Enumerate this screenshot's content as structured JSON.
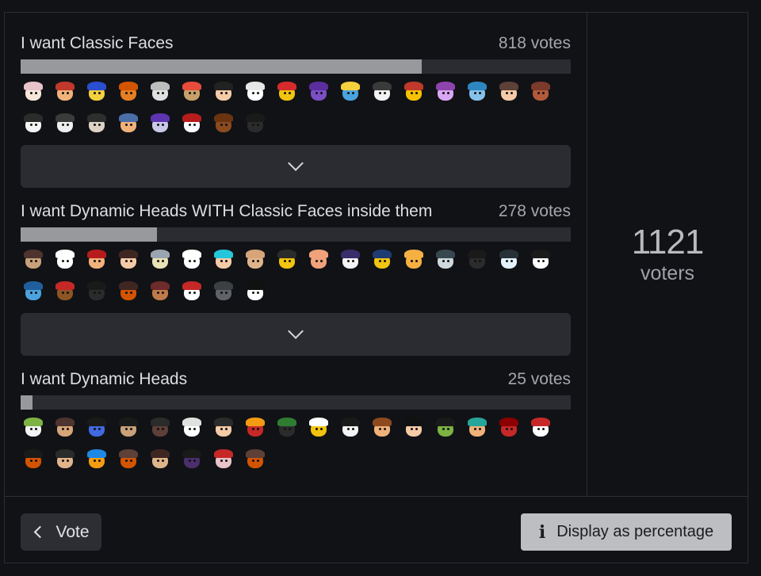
{
  "poll": {
    "total_voters": "1121",
    "voters_label": "voters",
    "options": [
      {
        "label": "I want Classic Faces",
        "votes": "818 votes",
        "fraction": 0.7297,
        "avatars": [
          {
            "skin": "#f6e7da",
            "hat": "#e8c3c9"
          },
          {
            "skin": "#f0b27a",
            "hat": "#c0392b"
          },
          {
            "skin": "#f4d03f",
            "hat": "#2a4fd0"
          },
          {
            "skin": "#e67e22",
            "hat": "#d35400"
          },
          {
            "skin": "#e0e0e0",
            "hat": "#bdbdbd"
          },
          {
            "skin": "#c8a06a",
            "hat": "#e74c3c"
          },
          {
            "skin": "#f5cba7",
            "hat": "#222222"
          },
          {
            "skin": "#ffffff",
            "hat": "#e7e7e7"
          },
          {
            "skin": "#f1c40f",
            "hat": "#d62b2b"
          },
          {
            "skin": "#7b4fc4",
            "hat": "#5b2e9e"
          },
          {
            "skin": "#4aa3df",
            "hat": "#f4d03f"
          },
          {
            "skin": "#f2f2f2",
            "hat": "#3a3a3a"
          },
          {
            "skin": "#f6c200",
            "hat": "#c0392b"
          },
          {
            "skin": "#d9a7f2",
            "hat": "#8e44ad"
          },
          {
            "skin": "#85c1e9",
            "hat": "#2e86c1"
          },
          {
            "skin": "#f5cba7",
            "hat": "#5d4037"
          },
          {
            "skin": "#b35a3a",
            "hat": "#7b3a2a"
          },
          {
            "skin": "#f4f4f4",
            "hat": "#2b2b2b"
          },
          {
            "skin": "#eeeeee",
            "hat": "#3b3b3b"
          },
          {
            "skin": "#ddd2c4",
            "hat": "#2e2e2e"
          },
          {
            "skin": "#f0b27a",
            "hat": "#4a6ea8"
          },
          {
            "skin": "#c9c9e8",
            "hat": "#5e35b1"
          },
          {
            "skin": "#ffffff",
            "hat": "#b71c1c"
          },
          {
            "skin": "#8d4a1f",
            "hat": "#6b3410"
          },
          {
            "skin": "#2b2b2b",
            "hat": "#1a1a1a"
          }
        ]
      },
      {
        "label": "I want Dynamic Heads WITH Classic Faces inside them",
        "votes": "278 votes",
        "fraction": 0.248,
        "avatars": [
          {
            "skin": "#c8a07a",
            "hat": "#4e342e"
          },
          {
            "skin": "#ffffff",
            "hat": "#ffffff"
          },
          {
            "skin": "#f0b27a",
            "hat": "#b71c1c"
          },
          {
            "skin": "#f5cba7",
            "hat": "#3e2723"
          },
          {
            "skin": "#e9e3b5",
            "hat": "#9aa5b1"
          },
          {
            "skin": "#ffffff",
            "hat": "#ffffff"
          },
          {
            "skin": "#f5cba7",
            "hat": "#26c6da"
          },
          {
            "skin": "#e0b48a",
            "hat": "#d7a57a"
          },
          {
            "skin": "#f1c40f",
            "hat": "#2b2b2b"
          },
          {
            "skin": "#f0a27a",
            "hat": "#f0a27a"
          },
          {
            "skin": "#f4f4f4",
            "hat": "#3a2d6b"
          },
          {
            "skin": "#f1c40f",
            "hat": "#1f3b73"
          },
          {
            "skin": "#f5b041",
            "hat": "#f5b041"
          },
          {
            "skin": "#cfd8dc",
            "hat": "#37474f"
          },
          {
            "skin": "#2b2b2b",
            "hat": "#1a1a1a"
          },
          {
            "skin": "#e3f2fd",
            "hat": "#263238"
          },
          {
            "skin": "#ffffff",
            "hat": "#1a1a1a"
          },
          {
            "skin": "#4aa3df",
            "hat": "#1f5f9e"
          },
          {
            "skin": "#8d5524",
            "hat": "#c62828"
          },
          {
            "skin": "#2b2b2b",
            "hat": "#1a1a1a"
          },
          {
            "skin": "#d35400",
            "hat": "#3e2723"
          },
          {
            "skin": "#c0794a",
            "hat": "#6d2b2b"
          },
          {
            "skin": "#ffffff",
            "hat": "#c62828"
          },
          {
            "skin": "#5f6368",
            "hat": "#3c4043"
          },
          {
            "skin": "#ffffff",
            "hat": "#111111"
          }
        ]
      },
      {
        "label": "I want Dynamic Heads",
        "votes": "25 votes",
        "fraction": 0.0223,
        "avatars": [
          {
            "skin": "#f4f4f4",
            "hat": "#7cb342"
          },
          {
            "skin": "#d7a57a",
            "hat": "#4e342e"
          },
          {
            "skin": "#4169e1",
            "hat": "#1a1a1a"
          },
          {
            "skin": "#c8a07a",
            "hat": "#1a1a1a"
          },
          {
            "skin": "#5d4037",
            "hat": "#2b2b2b"
          },
          {
            "skin": "#ffffff",
            "hat": "#e0e0e0"
          },
          {
            "skin": "#f5cba7",
            "hat": "#2b2b2b"
          },
          {
            "skin": "#c62828",
            "hat": "#f39c12"
          },
          {
            "skin": "#2b2b2b",
            "hat": "#2e7d32"
          },
          {
            "skin": "#f1c40f",
            "hat": "#ffffff"
          },
          {
            "skin": "#f4f4f4",
            "hat": "#1a1a1a"
          },
          {
            "skin": "#f0b27a",
            "hat": "#8d4a1f"
          },
          {
            "skin": "#f5cba7",
            "hat": "#111111"
          },
          {
            "skin": "#7cb342",
            "hat": "#1a1a1a"
          },
          {
            "skin": "#f0b27a",
            "hat": "#26a69a"
          },
          {
            "skin": "#c62828",
            "hat": "#8b0000"
          },
          {
            "skin": "#ffffff",
            "hat": "#c62828"
          },
          {
            "skin": "#d35400",
            "hat": "#1a1a1a"
          },
          {
            "skin": "#e0b48a",
            "hat": "#2b2b2b"
          },
          {
            "skin": "#f39c12",
            "hat": "#1e88e5"
          },
          {
            "skin": "#d35400",
            "hat": "#5d4037"
          },
          {
            "skin": "#e0b48a",
            "hat": "#3e2723"
          },
          {
            "skin": "#4a2f6b",
            "hat": "#1a1a1a"
          },
          {
            "skin": "#e8c3c9",
            "hat": "#c62828"
          },
          {
            "skin": "#d35400",
            "hat": "#5d4037"
          }
        ]
      }
    ]
  },
  "footer": {
    "vote_label": "Vote",
    "percentage_label": "Display as percentage"
  },
  "icons": {
    "expand": "chevron-down-icon",
    "back": "chevron-left-icon",
    "info": "info-icon"
  }
}
